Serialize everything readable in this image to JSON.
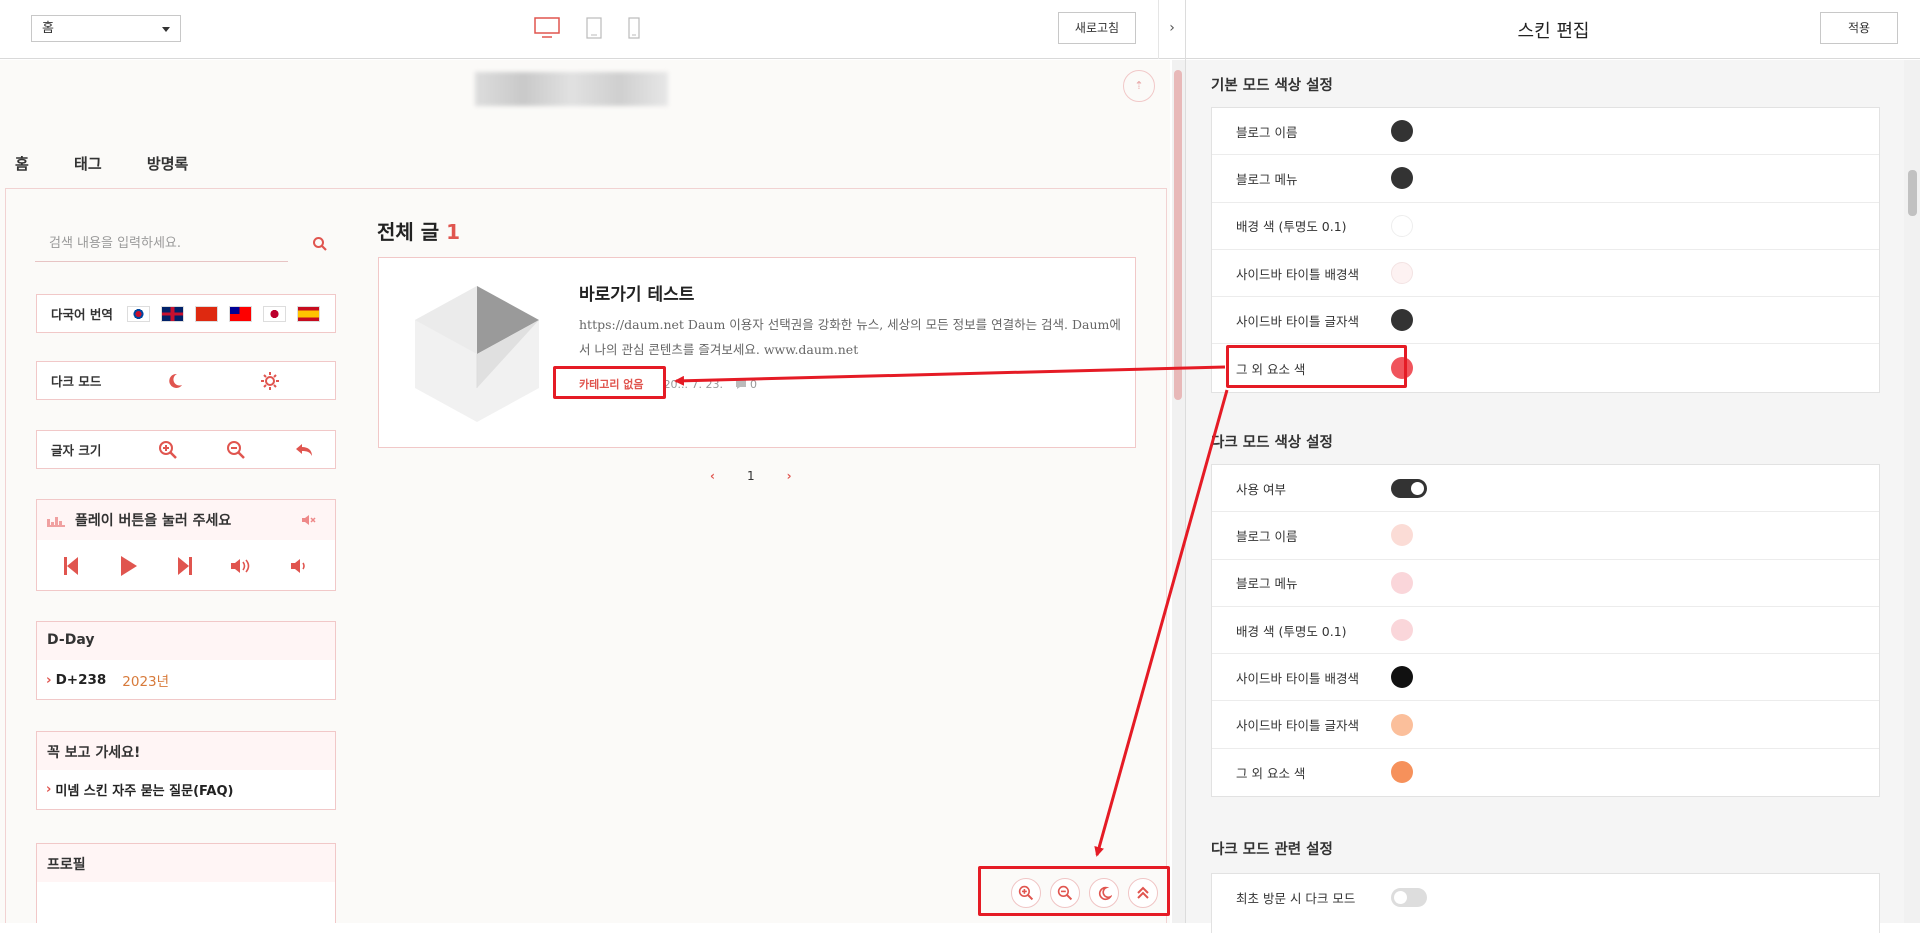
{
  "toolbar": {
    "page_select": "홈",
    "refresh_label": "새로고침",
    "collapse_glyph": "›"
  },
  "preview": {
    "gnb": [
      "홈",
      "태그",
      "방명록"
    ],
    "search_placeholder": "검색 내용을 입력하세요.",
    "translate_label": "다국어 번역",
    "dark_mode_label": "다크 모드",
    "font_size_label": "글자 크기",
    "music_title": "플레이 버튼을 눌러 주세요",
    "dday": {
      "title": "D-Day",
      "value": "D+238",
      "year": "2023년"
    },
    "must_see": {
      "title": "꼭 보고 가세요!",
      "item": "미넴 스킨 자주 묻는 질문(FAQ)"
    },
    "profile_title": "프로필",
    "list_title": "전체 글",
    "list_count": "1",
    "post": {
      "title": "바로가기 테스트",
      "description": "https://daum.net Daum 이용자 선택권을 강화한 뉴스, 세상의 모든 정보를 연결하는 검색. Daum에서 나의 관심 콘텐츠를 즐겨보세요. www.daum.net",
      "category": "카테고리 없음",
      "date": "20... 7. 23.",
      "comments": "0"
    },
    "pager": {
      "prev": "‹",
      "current": "1",
      "next": "›"
    }
  },
  "panel": {
    "title": "스킨 편집",
    "apply_label": "적용",
    "basic": {
      "title": "기본 모드 색상 설정",
      "rows": [
        {
          "label": "블로그 이름",
          "color": "#333333"
        },
        {
          "label": "블로그 메뉴",
          "color": "#333333"
        },
        {
          "label": "배경 색 (투명도 0.1)",
          "color": "#ffffff"
        },
        {
          "label": "사이드바 타이틀 배경색",
          "color": "#fdf2f2"
        },
        {
          "label": "사이드바 타이틀 글자색",
          "color": "#333333"
        },
        {
          "label": "그 외 요소 색",
          "color": "#f0545c"
        }
      ]
    },
    "dark": {
      "title": "다크 모드 색상 설정",
      "use_label": "사용 여부",
      "use_enabled": true,
      "rows": [
        {
          "label": "블로그 이름",
          "color": "#fbdcd6"
        },
        {
          "label": "블로그 메뉴",
          "color": "#fad6da"
        },
        {
          "label": "배경 색 (투명도 0.1)",
          "color": "#fad6da"
        },
        {
          "label": "사이드바 타이틀 배경색",
          "color": "#111111"
        },
        {
          "label": "사이드바 타이틀 글자색",
          "color": "#fbbf9b"
        },
        {
          "label": "그 외 요소 색",
          "color": "#f6915b"
        }
      ]
    },
    "dark_related": {
      "title": "다크 모드 관련 설정",
      "first_visit_label": "최초 방문 시 다크 모드",
      "first_visit_enabled": false
    }
  },
  "colors": {
    "accent": "#e0554f",
    "annotation": "#e51b25"
  }
}
